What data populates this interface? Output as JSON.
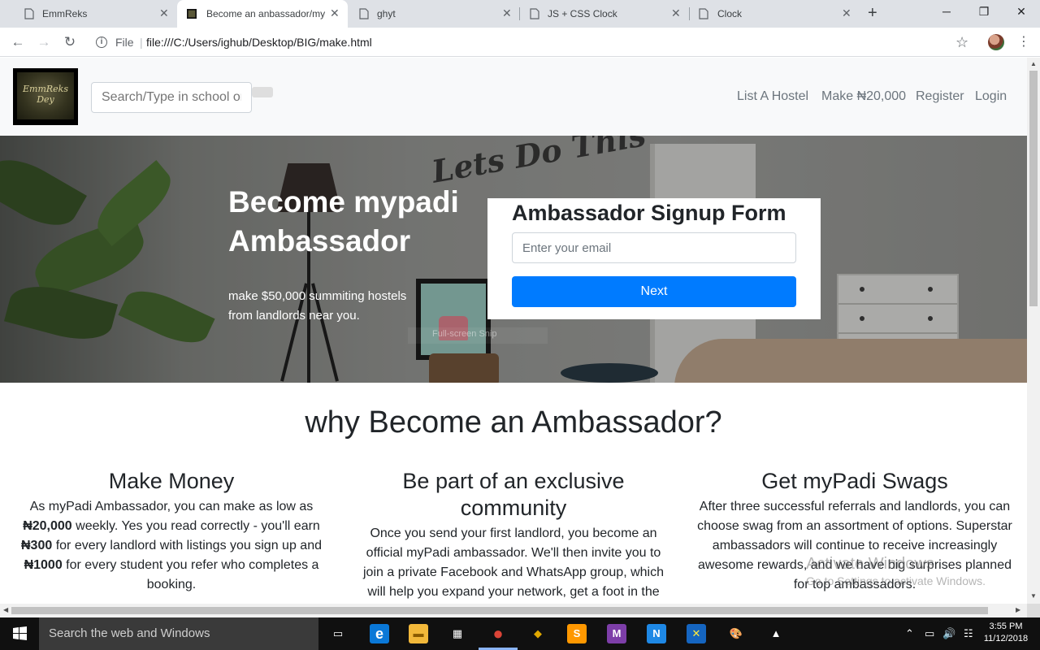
{
  "browser": {
    "tabs": [
      {
        "title": "EmmReks",
        "active": false
      },
      {
        "title": "Become an anbassador/my",
        "active": true
      },
      {
        "title": "ghyt",
        "active": false
      },
      {
        "title": "JS + CSS Clock",
        "active": false
      },
      {
        "title": "Clock",
        "active": false
      }
    ],
    "close_glyph": "✕",
    "new_tab_glyph": "+",
    "window_controls": {
      "minimize": "─",
      "restore": "❐",
      "close": "✕"
    },
    "nav": {
      "back": "←",
      "forward": "→",
      "reload": "↻"
    },
    "omnibox": {
      "scheme_label": "File",
      "url": "file:///C:/Users/ighub/Desktop/BIG/make.html",
      "bookmark_glyph": "☆"
    },
    "menu_glyph": "⋮"
  },
  "site": {
    "logo_text": "EmmReks Dey",
    "search_placeholder": "Search/Type in school or",
    "nav_links": [
      "List A Hostel",
      "Make ₦20,000",
      "Register",
      "Login"
    ]
  },
  "hero": {
    "wall_text": "Lets Do This",
    "title": "Become mypadi Ambassador",
    "subtitle": "make $50,000 summiting hostels from landlords near you.",
    "ghost_text": "Full-screen Snip"
  },
  "form": {
    "title": "Ambassador Signup Form",
    "email_placeholder": "Enter your email",
    "submit_label": "Next"
  },
  "why": {
    "title": "why Become an Ambassador?",
    "columns": [
      {
        "heading": "Make Money",
        "p1": "As myPadi Ambassador, you can make as low as",
        "b1": "₦20,000",
        "p2": " weekly. Yes you read correctly - you'll earn",
        "b2": "₦300",
        "p3": " for every landlord with listings you sign up and",
        "b3": "₦1000",
        "p4": " for every student you refer who completes a booking."
      },
      {
        "heading": "Be part of an exclusive community",
        "text": "Once you send your first landlord, you become an official myPadi ambassador. We'll then invite you to join a private Facebook and WhatsApp group, which will help you expand your network, get a foot in the"
      },
      {
        "heading": "Get myPadi Swags",
        "text": "After three successful referrals and landlords, you can choose swag from an assortment of options. Superstar ambassadors will continue to receive increasingly awesome rewards, and we have big surprises planned for top ambassadors."
      }
    ]
  },
  "watermark": {
    "line1": "Activate Windows",
    "line2": "Go to Settings to activate Windows."
  },
  "scroll": {
    "up": "▲",
    "down": "▼",
    "left": "◀",
    "right": "▶"
  },
  "taskbar": {
    "search_placeholder": "Search the web and Windows",
    "apps": [
      {
        "name": "task-view",
        "glyph": "▭",
        "color": "#101010"
      },
      {
        "name": "edge",
        "glyph": "e",
        "color": "#0a78d7"
      },
      {
        "name": "file-explorer",
        "glyph": "▬",
        "color": "#f2b83a"
      },
      {
        "name": "store",
        "glyph": "▦",
        "color": "#ffffff"
      },
      {
        "name": "chrome",
        "glyph": "●",
        "color": "#db4437"
      },
      {
        "name": "app-diamond",
        "glyph": "◆",
        "color": "#2c2c2c"
      },
      {
        "name": "sublime",
        "glyph": "S",
        "color": "#ff9800"
      },
      {
        "name": "app-m",
        "glyph": "M",
        "color": "#7d3ea8"
      },
      {
        "name": "app-n",
        "glyph": "N",
        "color": "#1e88e5"
      },
      {
        "name": "app-x",
        "glyph": "✕",
        "color": "#1565c0"
      },
      {
        "name": "paint",
        "glyph": "🎨",
        "color": "#2c2c2c"
      },
      {
        "name": "photos",
        "glyph": "▲",
        "color": "#2c2c2c"
      }
    ],
    "tray": {
      "up": "⌃",
      "battery": "▭",
      "volume": "🔊",
      "network": "☷"
    },
    "time": "3:55 PM",
    "date": "11/12/2018"
  },
  "colors": {
    "primary_button": "#007bff",
    "nav_bg": "#f8f9fa",
    "text_dark": "#212529",
    "taskbar": "#101010"
  }
}
